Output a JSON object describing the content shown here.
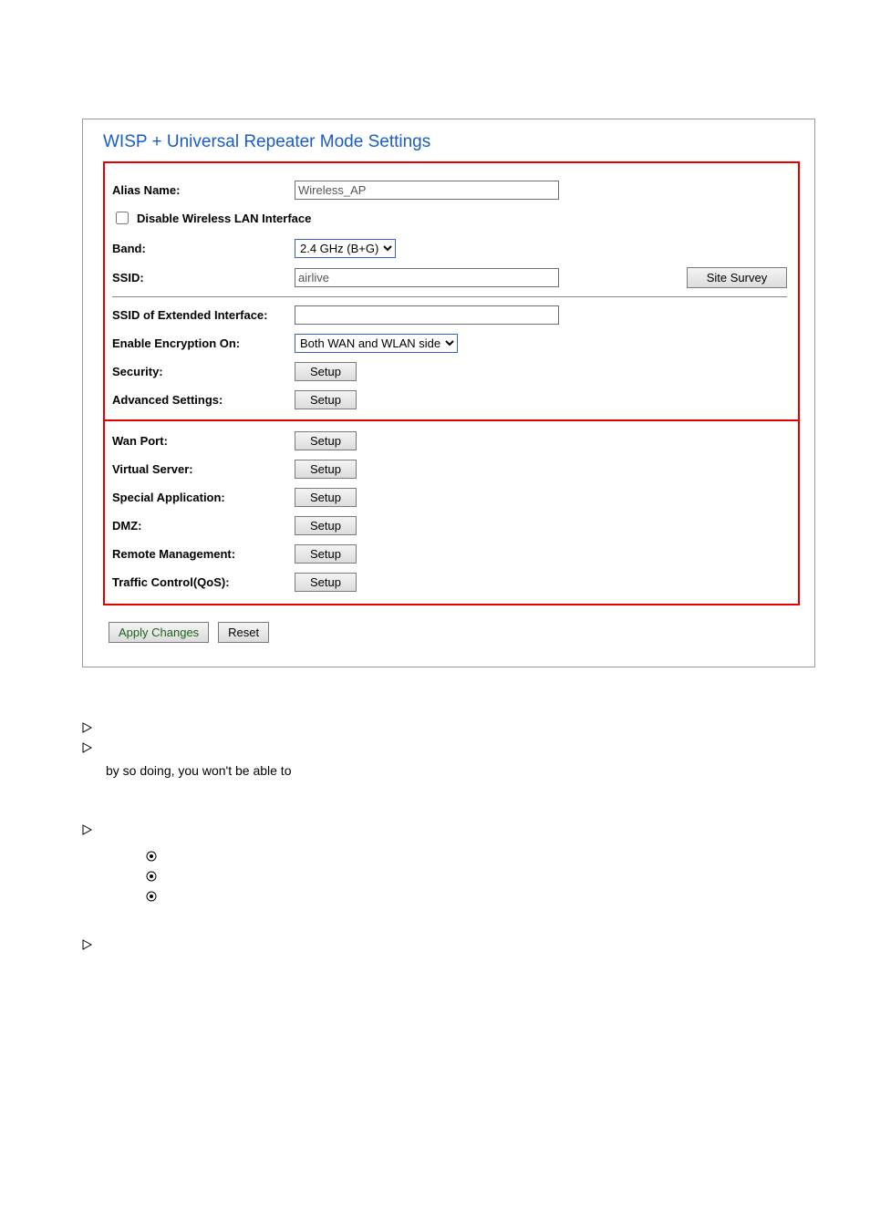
{
  "title": "WISP + Universal Repeater Mode Settings",
  "labels": {
    "alias": "Alias Name:",
    "disable_wlan": "Disable Wireless LAN Interface",
    "band": "Band:",
    "ssid": "SSID:",
    "ssid_ext": "SSID of Extended Interface:",
    "enable_enc": "Enable Encryption On:",
    "security": "Security:",
    "advanced": "Advanced Settings:",
    "wan_port": "Wan Port:",
    "virtual_server": "Virtual Server:",
    "special_app": "Special Application:",
    "dmz": "DMZ:",
    "remote_mgmt": "Remote Management:",
    "qos": "Traffic Control(QoS):"
  },
  "values": {
    "alias": "Wireless_AP",
    "band": "2.4 GHz (B+G)",
    "ssid": "airlive",
    "ssid_ext": "",
    "enable_enc": "Both WAN and WLAN side"
  },
  "buttons": {
    "setup": "Setup",
    "site_survey": "Site Survey",
    "apply": "Apply Changes",
    "reset": "Reset"
  },
  "notes": {
    "line2": "by so doing, you won't be able to"
  }
}
